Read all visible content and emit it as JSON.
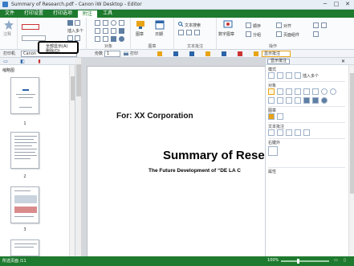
{
  "window": {
    "title": "Summary of Research.pdf - Canon iW Desktop - Editor",
    "minimize": "─",
    "maximize": "□",
    "close": "✕"
  },
  "ribbon_tabs": [
    {
      "label": "文件"
    },
    {
      "label": "打印设置"
    },
    {
      "label": "打印选项"
    },
    {
      "label": "附注"
    },
    {
      "label": "工具"
    }
  ],
  "ribbon": {
    "stamp_label": "注释",
    "annotation_label": "全部显示(A)",
    "delete_label": "删除(D)",
    "insert_multi": "插入多个",
    "group_format": "格式",
    "group_object": "对象",
    "group_figure": "图章",
    "group_text": "文本批注",
    "group_ops": "操作",
    "btn_figure": "图章",
    "btn_date": "日期",
    "btn_text_find": "文本搜索",
    "btn_hyperlink": "数字图章",
    "btn_order": "顺序",
    "btn_align": "对齐",
    "btn_group": "分组",
    "btn_pagemode": "页面组件"
  },
  "toolbar": {
    "print_label": "打印机",
    "printer_value": "Canon",
    "copies_label": "份数",
    "copies_value": "1",
    "print_btn": "打印",
    "show_annot": "显示批注"
  },
  "left_panel": {
    "title": "缩略图",
    "pages": [
      "1",
      "2",
      "3"
    ]
  },
  "document": {
    "for_line": "For: XX Corporation",
    "title": "Summary of Rese",
    "subtitle": "The Future Development of “DE LA C"
  },
  "right_panel": {
    "section_format": "模式",
    "insert_multi": "插入多个",
    "section_object": "对象",
    "section_figure": "图章",
    "section_text": "文本批注",
    "section_stamp": "右键外",
    "section_props": "属性"
  },
  "status": {
    "page_info": "所选页面 /11",
    "zoom": "100%"
  },
  "tooltip": {
    "line1": "全部显示(A)",
    "line2": "删除(D)"
  },
  "colors": {
    "ribbon_green": "#1e7a2e",
    "status_green": "#1e7a2e",
    "selection_orange": "#e8a317"
  }
}
